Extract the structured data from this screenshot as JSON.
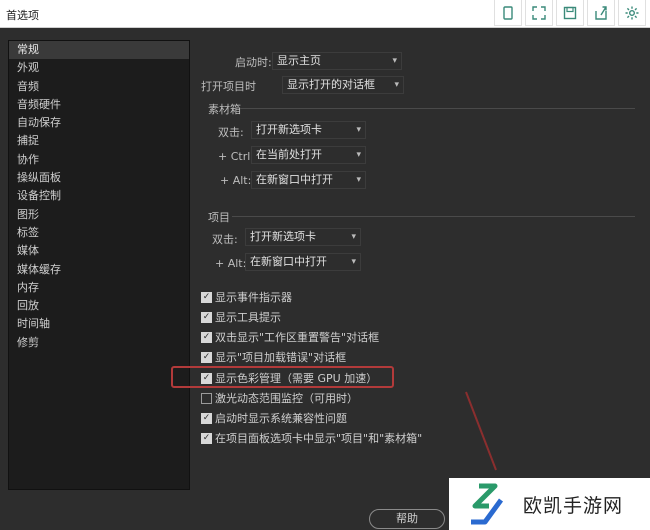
{
  "window": {
    "title": "首选项"
  },
  "toolbar_icons": [
    "tablet-icon",
    "expand-icon",
    "save-icon",
    "share-icon",
    "settings-icon"
  ],
  "sidebar": {
    "items": [
      {
        "label": "常规",
        "active": true
      },
      {
        "label": "外观"
      },
      {
        "label": "音频"
      },
      {
        "label": "音频硬件"
      },
      {
        "label": "自动保存"
      },
      {
        "label": "捕捉"
      },
      {
        "label": "协作"
      },
      {
        "label": "操纵面板"
      },
      {
        "label": "设备控制"
      },
      {
        "label": "图形"
      },
      {
        "label": "标签"
      },
      {
        "label": "媒体"
      },
      {
        "label": "媒体缓存"
      },
      {
        "label": "内存"
      },
      {
        "label": "回放"
      },
      {
        "label": "时间轴"
      },
      {
        "label": "修剪"
      }
    ]
  },
  "general": {
    "startup_label": "启动时:",
    "startup_value": "显示主页",
    "open_project_label": "打开项目时",
    "open_project_value": "显示打开的对话框",
    "bins": {
      "title": "素材箱",
      "double_click_label": "双击:",
      "double_click_value": "打开新选项卡",
      "ctrl_label": "+ Ctrl:",
      "ctrl_value": "在当前处打开",
      "alt_label": "+ Alt:",
      "alt_value": "在新窗口中打开"
    },
    "project": {
      "title": "项目",
      "double_click_label": "双击:",
      "double_click_value": "打开新选项卡",
      "alt_label": "+ Alt:",
      "alt_value": "在新窗口中打开"
    },
    "checkboxes": [
      {
        "label": "显示事件指示器",
        "checked": true
      },
      {
        "label": "显示工具提示",
        "checked": true
      },
      {
        "label": "双击显示\"工作区重置警告\"对话框",
        "checked": true
      },
      {
        "label": "显示\"项目加载错误\"对话框",
        "checked": true
      },
      {
        "label": "显示色彩管理（需要 GPU 加速）",
        "checked": true
      },
      {
        "label": "激光动态范围监控（可用时）",
        "checked": false
      },
      {
        "label": "启动时显示系统兼容性问题",
        "checked": true
      },
      {
        "label": "在项目面板选项卡中显示\"项目\"和\"素材箱\"",
        "checked": true
      }
    ]
  },
  "help_button": "帮助",
  "watermark": {
    "text": "欧凯手游网"
  },
  "colors": {
    "highlight": "#b23a3a",
    "background": "#2d2d2d",
    "sidebar": "#1c1c1c"
  }
}
